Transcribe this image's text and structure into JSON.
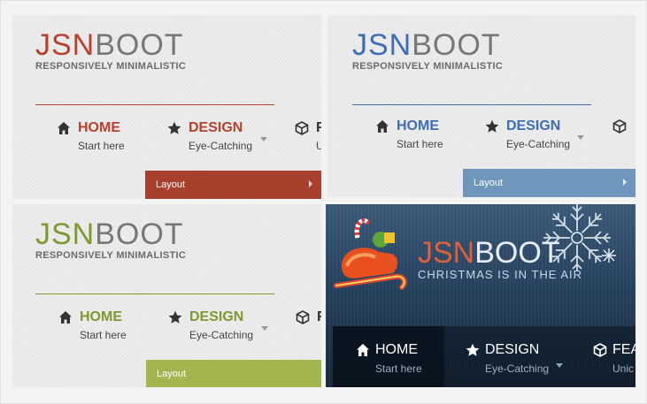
{
  "themes": [
    {
      "id": "red",
      "logo_jsn": "JSN",
      "logo_boot": "BOOT",
      "tagline": "RESPONSIVELY MINIMALISTIC",
      "accent": "#b8412d",
      "bar_color": "#a8402d",
      "nav": [
        {
          "title": "HOME",
          "sub": "Start here",
          "icon": "home-icon"
        },
        {
          "title": "DESIGN",
          "sub": "Eye-Catching",
          "icon": "star-icon"
        },
        {
          "title": "F",
          "sub": "U",
          "icon": "cube-icon"
        }
      ],
      "dropdown": "Layout"
    },
    {
      "id": "blue",
      "logo_jsn": "JSN",
      "logo_boot": "BOOT",
      "tagline": "RESPONSIVELY MINIMALISTIC",
      "accent": "#3e6db6",
      "bar_color": "#6f97bd",
      "nav": [
        {
          "title": "HOME",
          "sub": "Start here",
          "icon": "home-icon"
        },
        {
          "title": "DESIGN",
          "sub": "Eye-Catching",
          "icon": "star-icon"
        },
        {
          "title": "",
          "sub": "",
          "icon": "cube-icon"
        }
      ],
      "dropdown": "Layout"
    },
    {
      "id": "green",
      "logo_jsn": "JSN",
      "logo_boot": "BOOT",
      "tagline": "RESPONSIVELY MINIMALISTIC",
      "accent": "#7c9a2e",
      "bar_color": "#a2b54f",
      "nav": [
        {
          "title": "HOME",
          "sub": "Start here",
          "icon": "home-icon"
        },
        {
          "title": "DESIGN",
          "sub": "Eye-Catching",
          "icon": "star-icon"
        },
        {
          "title": "F",
          "sub": "",
          "icon": "cube-icon"
        }
      ],
      "dropdown": "Layout"
    },
    {
      "id": "christmas",
      "logo_jsn": "JSN",
      "logo_boot": "BOOT",
      "tagline": "CHRISTMAS IS IN THE AIR",
      "accent": "#e0603b",
      "nav": [
        {
          "title": "HOME",
          "sub": "Start here",
          "icon": "home-icon"
        },
        {
          "title": "DESIGN",
          "sub": "Eye-Catching",
          "icon": "star-icon"
        },
        {
          "title": "FEAT",
          "sub": "Unic",
          "icon": "cube-icon"
        }
      ]
    }
  ]
}
